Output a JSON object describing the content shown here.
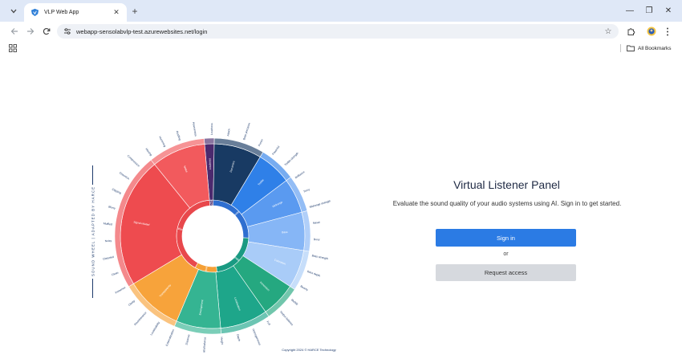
{
  "browser": {
    "tab_title": "VLP Web App",
    "url": "webapp-sensolabvlp-test.azurewebsites.net/login",
    "all_bookmarks_label": "All Bookmarks"
  },
  "panel": {
    "title": "Virtual Listener Panel",
    "subtitle": "Evaluate the sound quality of your audio systems using AI. Sign in to get started.",
    "signin_label": "Sign in",
    "or_label": "or",
    "request_label": "Request access"
  },
  "footer": {
    "copyright": "Copyright 2024 © HARCE Technology"
  },
  "wheel": {
    "side_title": "SOUND WHEEL | ADAPTED BY HARCE",
    "inner": [
      {
        "name": "Loudness",
        "span": 6,
        "color": "#4b2a6e"
      },
      {
        "name": "Timbre",
        "span": 92,
        "color": "#2f6fd0"
      },
      {
        "name": "Spatial",
        "span": 80,
        "color": "#1a9a82"
      },
      {
        "name": "Transparency",
        "span": 36,
        "color": "#f5a036"
      },
      {
        "name": "Artifacts",
        "span": 146,
        "color": "#e8484c"
      }
    ],
    "middle": [
      {
        "name": "Loudness",
        "span": 6,
        "color": "#4b2a6e"
      },
      {
        "name": "Dynamics",
        "span": 30,
        "color": "#183a63"
      },
      {
        "name": "Treble",
        "span": 22,
        "color": "#2f80e8"
      },
      {
        "name": "Midrange",
        "span": 22,
        "color": "#5a9af0"
      },
      {
        "name": "Bass",
        "span": 24,
        "color": "#86b6f6"
      },
      {
        "name": "Coloration",
        "span": 24,
        "color": "#a9ccf8"
      },
      {
        "name": "Immersion",
        "span": 22,
        "color": "#25a880"
      },
      {
        "name": "Localization",
        "span": 30,
        "color": "#1ea68a"
      },
      {
        "name": "Envelopment",
        "span": 28,
        "color": "#35b492"
      },
      {
        "name": "Transparency",
        "span": 36,
        "color": "#f7a33b"
      },
      {
        "name": "Signal-related",
        "span": 82,
        "color": "#ee4b4f"
      },
      {
        "name": "Noise",
        "span": 34,
        "color": "#f25a5d"
      }
    ],
    "outer_labels": [
      "Loudness",
      "Attack",
      "Bass precision",
      "Punch",
      "Powerful",
      "Treble strength",
      "Brilliance",
      "Tinny",
      "Midrange strength",
      "Nasal",
      "Boxy",
      "Bass strength",
      "Bass depth",
      "Boomy",
      "Muddy",
      "Timbre balance",
      "Full",
      "Homogeneous",
      "Depth",
      "Height",
      "Spatial balance",
      "Distance",
      "Externalization",
      "Localizability",
      "Reverberance",
      "Clarity",
      "Presence",
      "Clean",
      "Distorted",
      "Noisy",
      "Muffled",
      "Blurry",
      "Clipping",
      "Distortion",
      "Compression",
      "Hissing",
      "Humming",
      "Rustling",
      "Hoarseness"
    ]
  }
}
